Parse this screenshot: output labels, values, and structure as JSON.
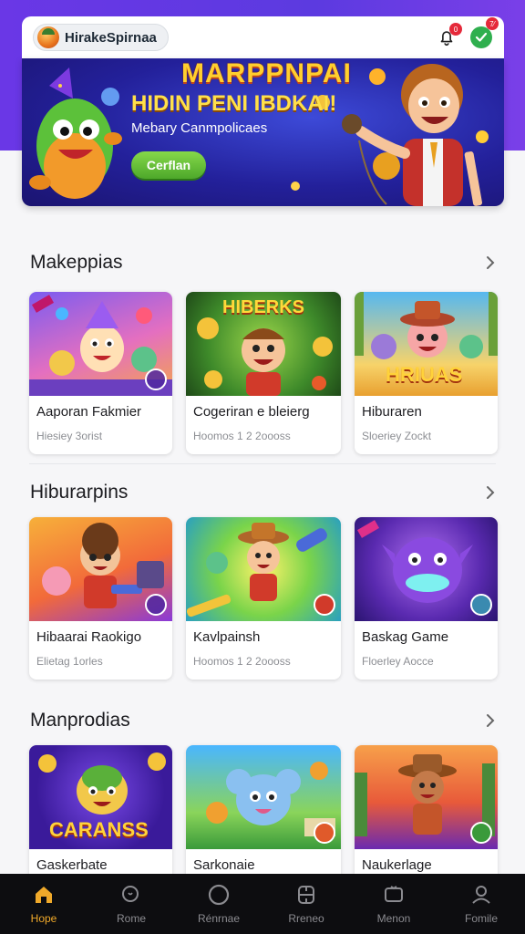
{
  "header": {
    "brand_name": "HirakeSpirnaa",
    "notification_count": "0",
    "badge_count": "7⁄"
  },
  "hero": {
    "title": "MARPPNPAI",
    "headline": "HIDIN PENI IBDKAI!",
    "subtitle": "Mebary Canmpolicaes",
    "cta_label": "Cerflan"
  },
  "sections": [
    {
      "title": "Makeppias",
      "cards": [
        {
          "title": "Aaporan Fakmier",
          "meta": "Hiesiey 3orist",
          "thumb_text": ""
        },
        {
          "title": "Cogeriran e bleierg",
          "meta": "Hoomos 1 2 2oooss",
          "thumb_text": "HIBERKS"
        },
        {
          "title": "Hiburaren",
          "meta": "Sloeriey Zockt",
          "thumb_text": "HRIUAS"
        }
      ]
    },
    {
      "title": "Hiburarpins",
      "cards": [
        {
          "title": "Hibaarai Raokigo",
          "meta": "Elietag 1orles",
          "thumb_text": ""
        },
        {
          "title": "Kavlpainsh",
          "meta": "Hoomos 1 2 2oooss",
          "thumb_text": ""
        },
        {
          "title": "Baskag Game",
          "meta": "Floerley Aocce",
          "thumb_text": ""
        }
      ]
    },
    {
      "title": "Manprodias",
      "cards": [
        {
          "title": "Gaskerbate",
          "meta": "",
          "thumb_text": "CARANSS"
        },
        {
          "title": "Sarkonaie",
          "meta": "",
          "thumb_text": ""
        },
        {
          "title": "Naukerlage",
          "meta": "",
          "thumb_text": ""
        }
      ]
    }
  ],
  "bottom_nav": [
    {
      "label": "Hope",
      "icon": "home-icon",
      "active": true
    },
    {
      "label": "Rome",
      "icon": "search-icon",
      "active": false
    },
    {
      "label": "Rénrnae",
      "icon": "circle-icon",
      "active": false
    },
    {
      "label": "Rreneo",
      "icon": "games-icon",
      "active": false
    },
    {
      "label": "Menon",
      "icon": "tv-icon",
      "active": false
    },
    {
      "label": "Fomile",
      "icon": "profile-icon",
      "active": false
    }
  ],
  "colors": {
    "accent": "#f0a92a",
    "header_bg": "#6a37e6",
    "cta_green": "#4da82a",
    "badge_red": "#e5293a"
  }
}
